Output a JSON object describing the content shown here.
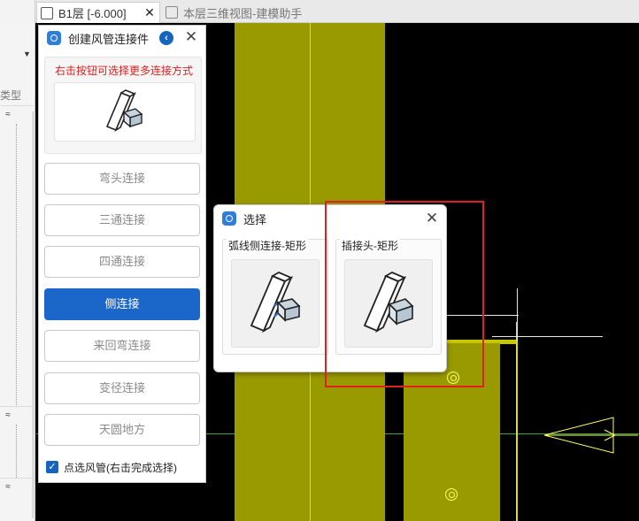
{
  "tabs": [
    {
      "title": "B1层 [-6.000]",
      "close": "✕",
      "icon": "floorplan-icon"
    },
    {
      "title": "本层三维视图-建模助手",
      "icon": "3d-box-icon"
    }
  ],
  "left_panel": {
    "type_label": "类型",
    "collapse_glyph": "≈",
    "dropdown_glyph": "▼"
  },
  "tool_panel": {
    "title": "创建风管连接件",
    "back_glyph": "‹",
    "close_glyph": "✕",
    "hint": "右击按钮可选择更多连接方式",
    "options": [
      "弯头连接",
      "三通连接",
      "四通连接",
      "侧连接",
      "来回弯连接",
      "变径连接",
      "天圆地方"
    ],
    "active_option": "侧连接",
    "pick_checkbox_label": "点选风管(右击完成选择)",
    "pick_checked": true,
    "check_glyph": "✓"
  },
  "dialog": {
    "title": "选择",
    "close_glyph": "✕",
    "cards": [
      {
        "label": "弧线侧连接-矩形"
      },
      {
        "label": "插接头-矩形"
      }
    ]
  },
  "colors": {
    "accent_blue": "#1a66c9",
    "hint_red": "#e02020",
    "duct_olive": "#999900",
    "highlight_red": "#e02020"
  }
}
